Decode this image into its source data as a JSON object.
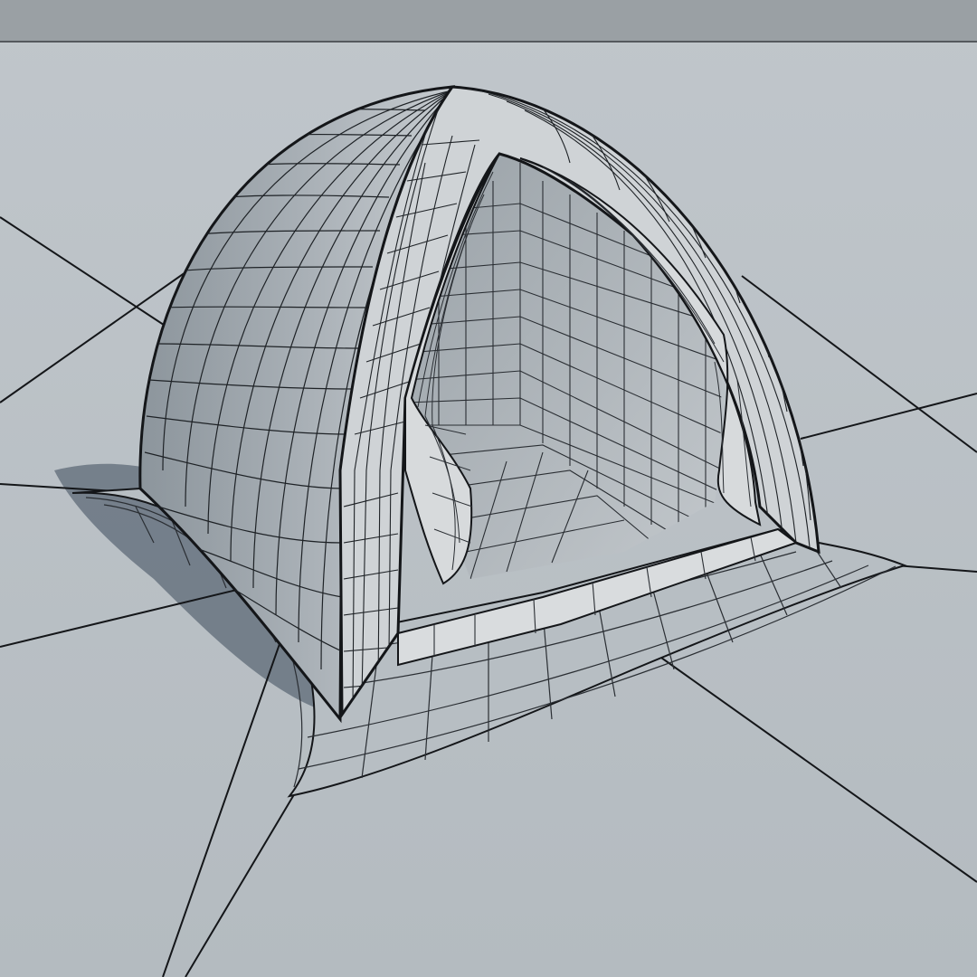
{
  "scene": {
    "subject": "tent",
    "render_style": "wireframe-over-shaded",
    "colors": {
      "background": "#b9c0c5",
      "horizon_band": "#9aa0a4",
      "floor": "#bcc2c7",
      "tent_shell": "#c9cdd0",
      "tent_shadow_side": "#8e979e",
      "interior": "#aeb4b9",
      "cast_shadow": "#5b6774",
      "wire": "#141619"
    }
  }
}
